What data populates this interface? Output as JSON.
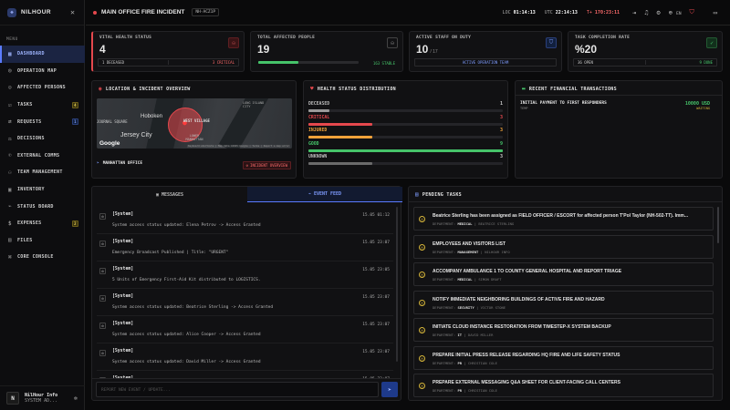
{
  "brand": {
    "name": "NILHOUR"
  },
  "sidebar": {
    "menu_label": "MENU",
    "items": [
      {
        "label": "DASHBOARD",
        "icon": "dashboard-icon",
        "active": true
      },
      {
        "label": "OPERATION MAP",
        "icon": "map-icon"
      },
      {
        "label": "AFFECTED PERSONS",
        "icon": "person-icon"
      },
      {
        "label": "TASKS",
        "icon": "tasks-icon",
        "badge": "4"
      },
      {
        "label": "REQUESTS",
        "icon": "requests-icon",
        "badge": "1"
      },
      {
        "label": "DECISIONS",
        "icon": "decisions-icon"
      },
      {
        "label": "EXTERNAL COMMS",
        "icon": "comms-icon"
      },
      {
        "label": "TEAM MANAGEMENT",
        "icon": "team-icon"
      },
      {
        "label": "INVENTORY",
        "icon": "inventory-icon"
      },
      {
        "label": "STATUS BOARD",
        "icon": "status-icon"
      },
      {
        "label": "EXPENSES",
        "icon": "expenses-icon",
        "badge": "2"
      },
      {
        "label": "FILES",
        "icon": "files-icon"
      },
      {
        "label": "CORE CONSOLE",
        "icon": "console-icon"
      }
    ],
    "user": {
      "initial": "N",
      "name": "NilHour Info",
      "role": "SYSTEM AD..."
    }
  },
  "header": {
    "incident_title": "MAIN OFFICE FIRE INCIDENT",
    "incident_code": "NH-ACZ1P",
    "loc_label": "LOC",
    "loc_time": "01:14:13",
    "utc_label": "UTC",
    "utc_time": "22:14:13",
    "tplus_label": "T+",
    "tplus_time": "170:23:11",
    "lang": "EN"
  },
  "stats": [
    {
      "label": "VITAL HEALTH STATUS",
      "value": "4",
      "foot_left": "1 DECEASED",
      "foot_right": "3 CRITICAL"
    },
    {
      "label": "TOTAL AFFECTED PEOPLE",
      "value": "19",
      "foot_right": "163 STABLE",
      "progress": 0.4
    },
    {
      "label": "ACTIVE STAFF ON DUTY",
      "value": "10",
      "sub": "/ 17",
      "foot_center": "ACTIVE OPERATION TEAM"
    },
    {
      "label": "TASK COMPLETION RATE",
      "value": "%20",
      "foot_left": "36 OPEN",
      "foot_right": "9 DONE"
    }
  ],
  "location": {
    "title": "LOCATION & INCIDENT OVERVIEW",
    "map_labels": [
      "Hoboken",
      "LONG ISLAND CITY",
      "WEST VILLAGE",
      "LOWER MANHATTAN",
      "Jersey City",
      "JOURNAL SQUARE"
    ],
    "map_attrib": "Keyboard shortcuts | Map data ©2025 Google | Terms | Report a map error",
    "office_label": "MANHATTAN OFFICE",
    "overview_btn": "INCIDENT OVERVIEW",
    "google": "Google"
  },
  "health": {
    "title": "HEALTH STATUS DISTRIBUTION",
    "rows": [
      {
        "label": "DECEASED",
        "value": "1",
        "color": "#9a9a9a",
        "pct": 0.11
      },
      {
        "label": "CRITICAL",
        "value": "3",
        "color": "#e5484d",
        "pct": 0.33
      },
      {
        "label": "INJURED",
        "value": "3",
        "color": "#f0a23a",
        "pct": 0.33
      },
      {
        "label": "GOOD",
        "value": "9",
        "color": "#46c46a",
        "pct": 1.0
      },
      {
        "label": "UNKNOWN",
        "value": "3",
        "color": "#6b6b6b",
        "pct": 0.33
      }
    ]
  },
  "finance": {
    "title": "RECENT FINANCIAL TRANSACTIONS",
    "items": [
      {
        "desc": "INITIAL PAYMENT TO FIRST RESPONDERS",
        "sub": "TEMP",
        "amount": "10000 USD",
        "status": "WAITING"
      }
    ]
  },
  "feed": {
    "tab_messages": "MESSAGES",
    "tab_events": "EVENT FEED",
    "items": [
      {
        "head": "[System]",
        "time": "15.05 01:12",
        "body": "System access status updated: Elena Petrov -> Access Granted"
      },
      {
        "head": "[System]",
        "time": "15.05 23:07",
        "body": "Emergency Broadcast Published | Title: \"URGENT\""
      },
      {
        "head": "[System]",
        "time": "15.05 23:05",
        "body": "5 Units of Emergency First-Aid Kit distributed to LOGISTICS."
      },
      {
        "head": "[System]",
        "time": "15.05 23:07",
        "body": "System access status updated: Beatrice Sterling -> Access Granted"
      },
      {
        "head": "[System]",
        "time": "15.05 23:07",
        "body": "System access status updated: Alice Cooper -> Access Granted"
      },
      {
        "head": "[System]",
        "time": "15.05 23:07",
        "body": "System access status updated: David Miller -> Access Granted"
      },
      {
        "head": "[System]",
        "time": "15.05 23:07",
        "body": ""
      }
    ],
    "input_placeholder": "REPORT NEW EVENT / UPDATE..."
  },
  "tasks": {
    "title": "PENDING TASKS",
    "items": [
      {
        "title": "Beatrice Sterling has been assigned as FIELD OFFICER / ESCORT for affected person T'Pol Taylor (NH-502-TT). Imm...",
        "dept": "MEDICAL",
        "person": "BEATRICE STERLING"
      },
      {
        "title": "EMPLOYEES AND VISITORS LIST",
        "dept": "MANAGEMENT",
        "person": "NILHOUR INFO"
      },
      {
        "title": "ACCOMPANY AMBULANCE 1 TO COUNTY GENERAL HOSPITAL AND REPORT TRIAGE",
        "dept": "MEDICAL",
        "person": "SIMON DRAFT"
      },
      {
        "title": "NOTIFY IMMEDIATE NEIGHBORING BUILDINGS OF ACTIVE FIRE AND HAZARD",
        "dept": "SECURITY",
        "person": "VICTOR STONE"
      },
      {
        "title": "INITIATE CLOUD INSTANCE RESTORATION FROM TIMESTEP-X SYSTEM BACKUP",
        "dept": "IT",
        "person": "DAVID MILLER"
      },
      {
        "title": "PREPARE INITIAL PRESS RELEASE REGARDING HQ FIRE AND LIFE SAFETY STATUS",
        "dept": "PR",
        "person": "CHRISTIAN COLE"
      },
      {
        "title": "PREPARE EXTERNAL MESSAGING Q&A SHEET FOR CLIENT-FACING CALL CENTERS",
        "dept": "PR",
        "person": "CHRISTIAN COLE"
      }
    ],
    "dept_label": "DEPARTMENT:"
  }
}
